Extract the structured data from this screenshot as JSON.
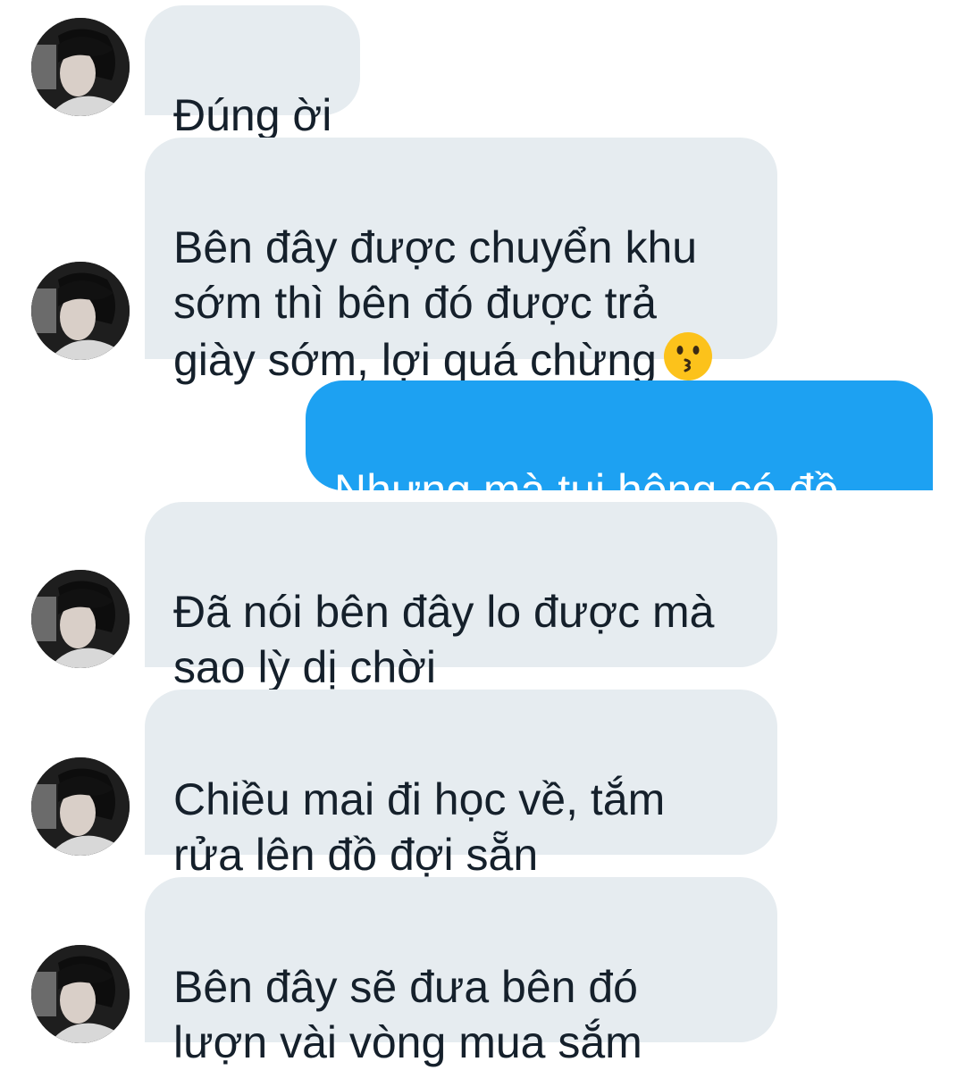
{
  "conversation": {
    "messages": [
      {
        "sender": "other",
        "text": "Đúng ời"
      },
      {
        "sender": "other",
        "text": "Bên đây được chuyển khu\nsớm thì bên đó được trả\ngiày sớm, lợi quá chừng",
        "emoji": "kissing-face-emoji"
      },
      {
        "sender": "me",
        "text": "Nhưng mà tui hông có đồ..."
      },
      {
        "sender": "other",
        "text": "Đã nói bên đây lo được mà\nsao lỳ dị chời"
      },
      {
        "sender": "other",
        "text": "Chiều mai đi học về, tắm\nrửa lên đồ đợi sẵn"
      },
      {
        "sender": "other",
        "text": "Bên đây sẽ đưa bên đó\nlượn vài vòng mua sắm"
      }
    ]
  },
  "colors": {
    "incoming_bubble": "#e6ecf0",
    "outgoing_bubble": "#1da1f2",
    "incoming_text": "#15202b",
    "outgoing_text": "#ffffff"
  }
}
